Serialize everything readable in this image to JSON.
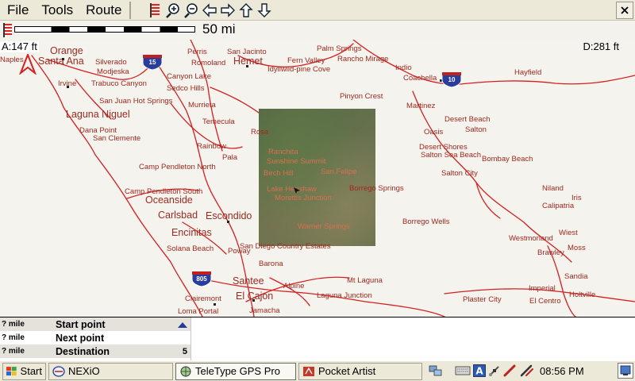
{
  "menu": {
    "items": [
      "File",
      "Tools",
      "Route"
    ]
  },
  "toolbar": {
    "buttons": [
      "track-flag-icon",
      "zoom-in-icon",
      "zoom-out-icon",
      "pan-left-icon",
      "pan-right-icon",
      "pan-up-icon",
      "pan-down-icon"
    ],
    "close": "close-icon"
  },
  "scale": {
    "label": "50 mi"
  },
  "status": {
    "altitude": "A:147 ft",
    "distance": "D:281 ft"
  },
  "map": {
    "places": [
      "Naples",
      "Orange",
      "Santa Ana",
      "Silverado",
      "Modjeska",
      "Irvine",
      "Trabuco Canyon",
      "San Juan Hot Springs",
      "Laguna Niguel",
      "Dana Point",
      "San Clemente",
      "Perris",
      "Romoland",
      "San Jacinto",
      "Hemet",
      "Palm Springs",
      "Fern Valley",
      "Rancho Mirage",
      "Idyllwild-pine Cove",
      "Indio",
      "Coachella",
      "Hayfield",
      "Canyon Lake",
      "Sedco Hills",
      "Murrieta",
      "Temecula",
      "Pinyon Crest",
      "Martinez",
      "Desert Beach",
      "Oasis",
      "Salton",
      "Desert Shores",
      "Salton Sea Beach",
      "Bombay Beach",
      "Salton City",
      "Rainbow",
      "Pala",
      "Camp Pendleton North",
      "Camp Pendleton South",
      "Oceanside",
      "Carlsbad",
      "Escondido",
      "Encinitas",
      "Solana Beach",
      "Poway",
      "San Diego Country Estates",
      "Barona",
      "Santee",
      "Alpine",
      "Mt Laguna",
      "El Cajon",
      "Laguna Junction",
      "Clairemont",
      "Loma Portal",
      "Jamacha",
      "Niland",
      "Iris",
      "Calipatria",
      "Borrego Springs",
      "Borrego Wells",
      "Westmorland",
      "Wiest",
      "Brawley",
      "Moss",
      "Sandia",
      "Imperial",
      "Plaster City",
      "El Centro",
      "Holtville",
      "Rosa",
      "Ranchita",
      "Sunshine Summit",
      "Birch Hill",
      "San Felipe",
      "Lake Henshaw",
      "Morettis Junction",
      "Warner Springs"
    ],
    "highways": [
      "15",
      "10",
      "805"
    ],
    "colors": {
      "road": "#d42020",
      "label": "#a0291f",
      "background": "#f5f3ee"
    }
  },
  "route": {
    "rows": [
      {
        "dist": "? mile",
        "label": "Start point",
        "count": ""
      },
      {
        "dist": "? mile",
        "label": "Next point",
        "count": ""
      },
      {
        "dist": "? mile",
        "label": "Destination",
        "count": "5"
      }
    ],
    "scroll_up": "arrow-up-icon"
  },
  "taskbar": {
    "start": "Start",
    "tasks": [
      "NEXiO",
      "TeleType GPS Pro",
      "Pocket Artist"
    ],
    "clock": "08:56 PM",
    "tray_icons": [
      "network-icon",
      "keyboard-icon",
      "font-a-icon",
      "satellite-icon",
      "pen-icon",
      "pen-settings-icon"
    ]
  }
}
